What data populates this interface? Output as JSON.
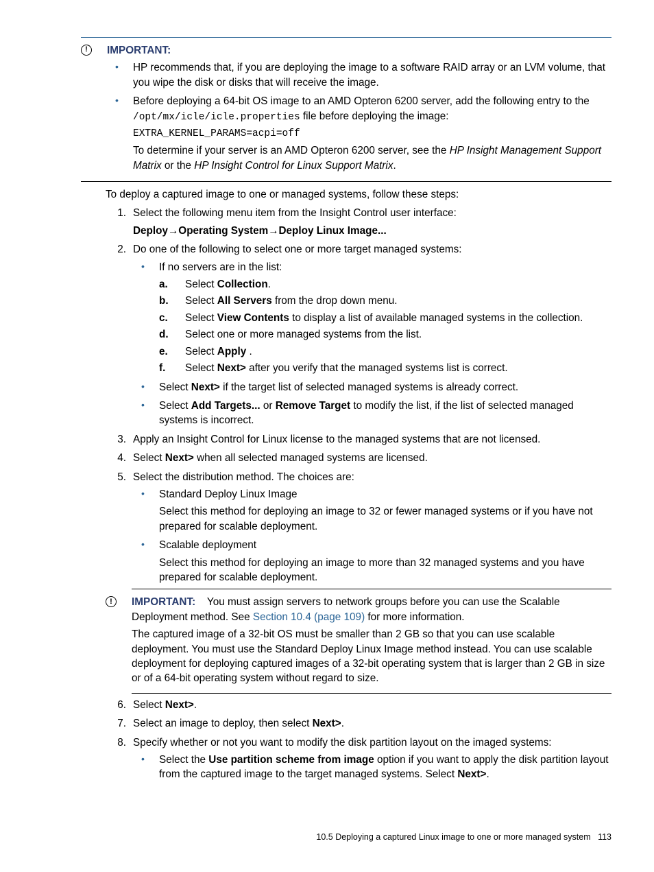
{
  "important1": {
    "label": "IMPORTANT:",
    "items": [
      "HP recommends that, if you are deploying the image to a software RAID array or an LVM volume, that you wipe the disk or disks that will receive the image.",
      {
        "pre": "Before deploying a 64-bit OS image to an AMD Opteron 6200 server, add the following entry to the ",
        "code_path": "/opt/mx/icle/icle.properties",
        "post": " file before deploying the image:",
        "codeblock": "EXTRA_KERNEL_PARAMS=acpi=off",
        "after1": "To determine if your server is an AMD Opteron 6200 server, see the ",
        "italic1": "HP Insight Management Support Matrix ",
        "mid": " or the ",
        "italic2": "HP Insight Control for Linux Support Matrix",
        "end": "."
      }
    ]
  },
  "intro_text": "To deploy a captured image to one or managed systems, follow these steps:",
  "steps": {
    "s1_a": "Select the following menu item from the Insight Control user interface:",
    "s1_b": "Deploy→Operating System→Deploy Linux Image...",
    "s2": "Do one of the following to select one or more target managed systems:",
    "s2_b1": "If no servers are in the list:",
    "s2_a_pre": "Select ",
    "s2_a_bold": "Collection",
    "s2_a_post": ".",
    "s2_b_pre": "Select ",
    "s2_b_bold": "All Servers",
    "s2_b_post": " from the drop down menu.",
    "s2_c_pre": "Select ",
    "s2_c_bold": "View Contents",
    "s2_c_post": " to display a list of available managed systems in the collection.",
    "s2_d": "Select one or more managed systems from the list.",
    "s2_e_pre": "Select ",
    "s2_e_bold": "Apply",
    "s2_e_post": " .",
    "s2_f_pre": "Select ",
    "s2_f_bold": "Next>",
    "s2_f_post": " after you verify that the managed systems list is correct.",
    "s2_b2_pre": "Select ",
    "s2_b2_bold": "Next>",
    "s2_b2_post": " if the target list of selected managed systems is already correct.",
    "s2_b3_pre": "Select ",
    "s2_b3_b1": "Add Targets...",
    "s2_b3_mid": " or ",
    "s2_b3_b2": "Remove Target",
    "s2_b3_post": " to modify the list, if the list of selected managed systems is incorrect.",
    "s3": "Apply an Insight Control for Linux license to the managed systems that are not licensed.",
    "s4_pre": "Select ",
    "s4_bold": "Next>",
    "s4_post": " when all selected managed systems are licensed.",
    "s5": "Select the distribution method. The choices are:",
    "s5_b1_t": "Standard Deploy Linux Image",
    "s5_b1_d": "Select this method for deploying an image to 32 or fewer managed systems or if you have not prepared for scalable deployment.",
    "s5_b2_t": "Scalable deployment",
    "s5_b2_d": "Select this method for deploying an image to more than 32 managed systems and you have prepared for scalable deployment.",
    "s6_pre": "Select ",
    "s6_bold": "Next>",
    "s6_post": ".",
    "s7_pre": "Select an image to deploy, then select ",
    "s7_bold": "Next>",
    "s7_post": ".",
    "s8": "Specify whether or not you want to modify the disk partition layout on the imaged systems:",
    "s8_b1_pre": "Select the ",
    "s8_b1_bold": "Use partition scheme from image",
    "s8_b1_mid": " option if you want to apply the disk partition layout from the captured image to the target managed systems. Select ",
    "s8_b1_bold2": "Next>",
    "s8_b1_post": "."
  },
  "important2": {
    "label": "IMPORTANT:",
    "t1a": "You must assign servers to network groups before you can use the Scalable Deployment method. See ",
    "link": "Section 10.4 (page 109)",
    "t1b": " for more information.",
    "t2": "The captured image of a 32-bit OS must be smaller than 2 GB so that you can use scalable deployment. You must use the Standard Deploy Linux Image method instead. You can use scalable deployment for deploying captured images of a 32-bit operating system that is larger than 2 GB in size or of a 64-bit operating system without regard to size."
  },
  "footer": {
    "section": "10.5 Deploying a captured Linux image to one or more managed system",
    "page": "113"
  }
}
